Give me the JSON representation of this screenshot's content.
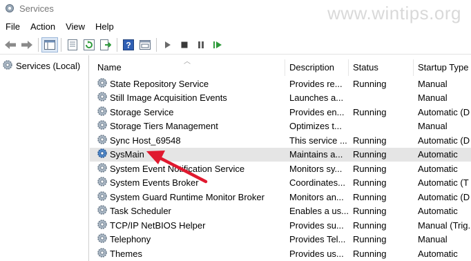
{
  "window": {
    "title": "Services",
    "watermark": "www.wintips.org"
  },
  "menu": [
    "File",
    "Action",
    "View",
    "Help"
  ],
  "toolbar": {
    "buttons": [
      "back-icon",
      "forward-icon",
      "show-hide-tree-icon",
      "properties-icon",
      "refresh-icon",
      "export-list-icon",
      "help-icon",
      "console-view-icon",
      "start-service-icon",
      "stop-service-icon",
      "pause-service-icon",
      "restart-service-icon"
    ]
  },
  "tree": {
    "root_label": "Services (Local)"
  },
  "table": {
    "columns": [
      "Name",
      "Description",
      "Status",
      "Startup Type"
    ],
    "rows": [
      {
        "name": "State Repository Service",
        "description": "Provides re...",
        "status": "Running",
        "startup": "Manual"
      },
      {
        "name": "Still Image Acquisition Events",
        "description": "Launches a...",
        "status": "",
        "startup": "Manual"
      },
      {
        "name": "Storage Service",
        "description": "Provides en...",
        "status": "Running",
        "startup": "Automatic (D"
      },
      {
        "name": "Storage Tiers Management",
        "description": "Optimizes t...",
        "status": "",
        "startup": "Manual"
      },
      {
        "name": "Sync Host_69548",
        "description": "This service ...",
        "status": "Running",
        "startup": "Automatic (D"
      },
      {
        "name": "SysMain",
        "description": "Maintains a...",
        "status": "Running",
        "startup": "Automatic"
      },
      {
        "name": "System Event Notification Service",
        "description": "Monitors sy...",
        "status": "Running",
        "startup": "Automatic"
      },
      {
        "name": "System Events Broker",
        "description": "Coordinates...",
        "status": "Running",
        "startup": "Automatic (T"
      },
      {
        "name": "System Guard Runtime Monitor Broker",
        "description": "Monitors an...",
        "status": "Running",
        "startup": "Automatic (D"
      },
      {
        "name": "Task Scheduler",
        "description": "Enables a us...",
        "status": "Running",
        "startup": "Automatic"
      },
      {
        "name": "TCP/IP NetBIOS Helper",
        "description": "Provides su...",
        "status": "Running",
        "startup": "Manual (Trig."
      },
      {
        "name": "Telephony",
        "description": "Provides Tel...",
        "status": "Running",
        "startup": "Manual"
      },
      {
        "name": "Themes",
        "description": "Provides us...",
        "status": "Running",
        "startup": "Automatic"
      }
    ],
    "highlighted_row": "SysMain"
  },
  "annotation": {
    "arrow_color": "#e0192f"
  }
}
